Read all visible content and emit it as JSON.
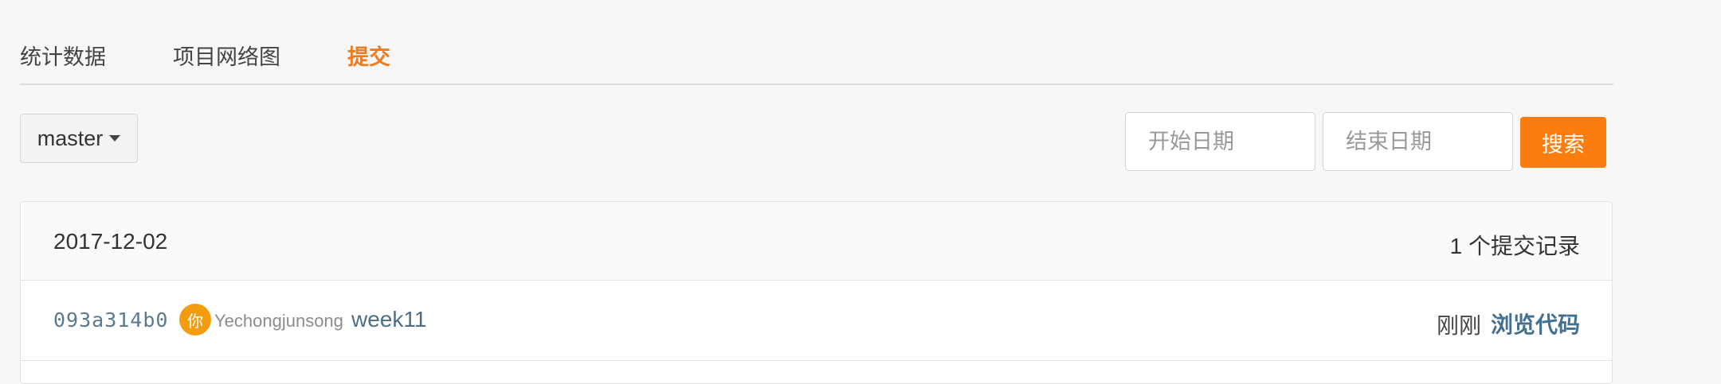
{
  "tabs": [
    {
      "label": "统计数据"
    },
    {
      "label": "项目网络图"
    },
    {
      "label": "提交",
      "active": true
    }
  ],
  "branch": {
    "label": "master"
  },
  "filters": {
    "start_placeholder": "开始日期",
    "end_placeholder": "结束日期",
    "search_label": "搜索"
  },
  "commit_groups": [
    {
      "date": "2017-12-02",
      "count_label": "1 个提交记录",
      "commits": [
        {
          "sha": "093a314b0",
          "avatar_text": "你",
          "author": "Yechongjunsong",
          "message": "week11",
          "time": "刚刚",
          "browse_label": "浏览代码"
        }
      ]
    }
  ],
  "colors": {
    "accent": "#fb7d0f",
    "active_tab": "#ee7b1c",
    "link": "#44708f",
    "avatar": "#f49c10"
  }
}
